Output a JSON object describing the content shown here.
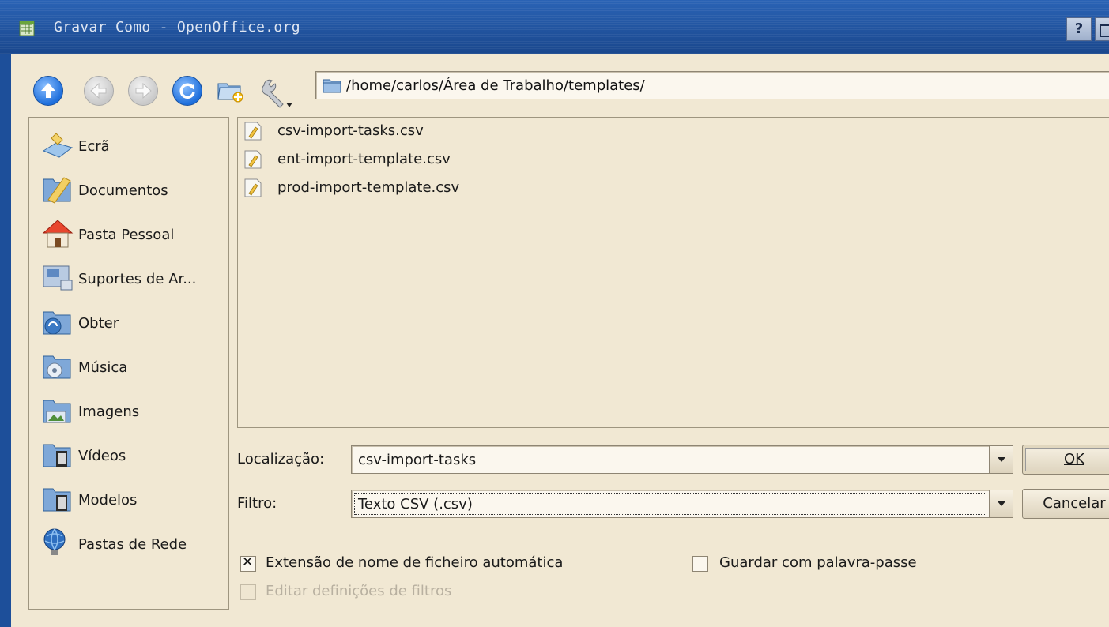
{
  "window": {
    "title": "Gravar Como - OpenOffice.org",
    "help_label": "?"
  },
  "toolbar": {
    "path": "/home/carlos/Área de Trabalho/templates/"
  },
  "sidebar": {
    "items": [
      {
        "label": "Ecrã",
        "icon": "desktop-icon"
      },
      {
        "label": "Documentos",
        "icon": "documents-icon"
      },
      {
        "label": "Pasta Pessoal",
        "icon": "home-icon"
      },
      {
        "label": "Suportes de Ar...",
        "icon": "storage-media-icon"
      },
      {
        "label": "Obter",
        "icon": "downloads-icon"
      },
      {
        "label": "Música",
        "icon": "music-folder-icon"
      },
      {
        "label": "Imagens",
        "icon": "pictures-folder-icon"
      },
      {
        "label": "Vídeos",
        "icon": "videos-folder-icon"
      },
      {
        "label": "Modelos",
        "icon": "templates-folder-icon"
      },
      {
        "label": "Pastas de Rede",
        "icon": "network-icon"
      }
    ]
  },
  "files": [
    {
      "name": "csv-import-tasks.csv"
    },
    {
      "name": "ent-import-template.csv"
    },
    {
      "name": "prod-import-template.csv"
    }
  ],
  "form": {
    "location_label": "Localização:",
    "location_value": "csv-import-tasks",
    "filter_label": "Filtro:",
    "filter_value": "Texto CSV (.csv)",
    "ok_label": "OK",
    "cancel_label": "Cancelar",
    "auto_ext_label": "Extensão de nome de ficheiro automática",
    "auto_ext_checked": true,
    "password_label": "Guardar com palavra-passe",
    "password_checked": false,
    "edit_filter_label": "Editar definições de filtros",
    "edit_filter_checked": false
  },
  "colors": {
    "titlebar": "#1d4f9a",
    "background": "#f1e8d3"
  }
}
